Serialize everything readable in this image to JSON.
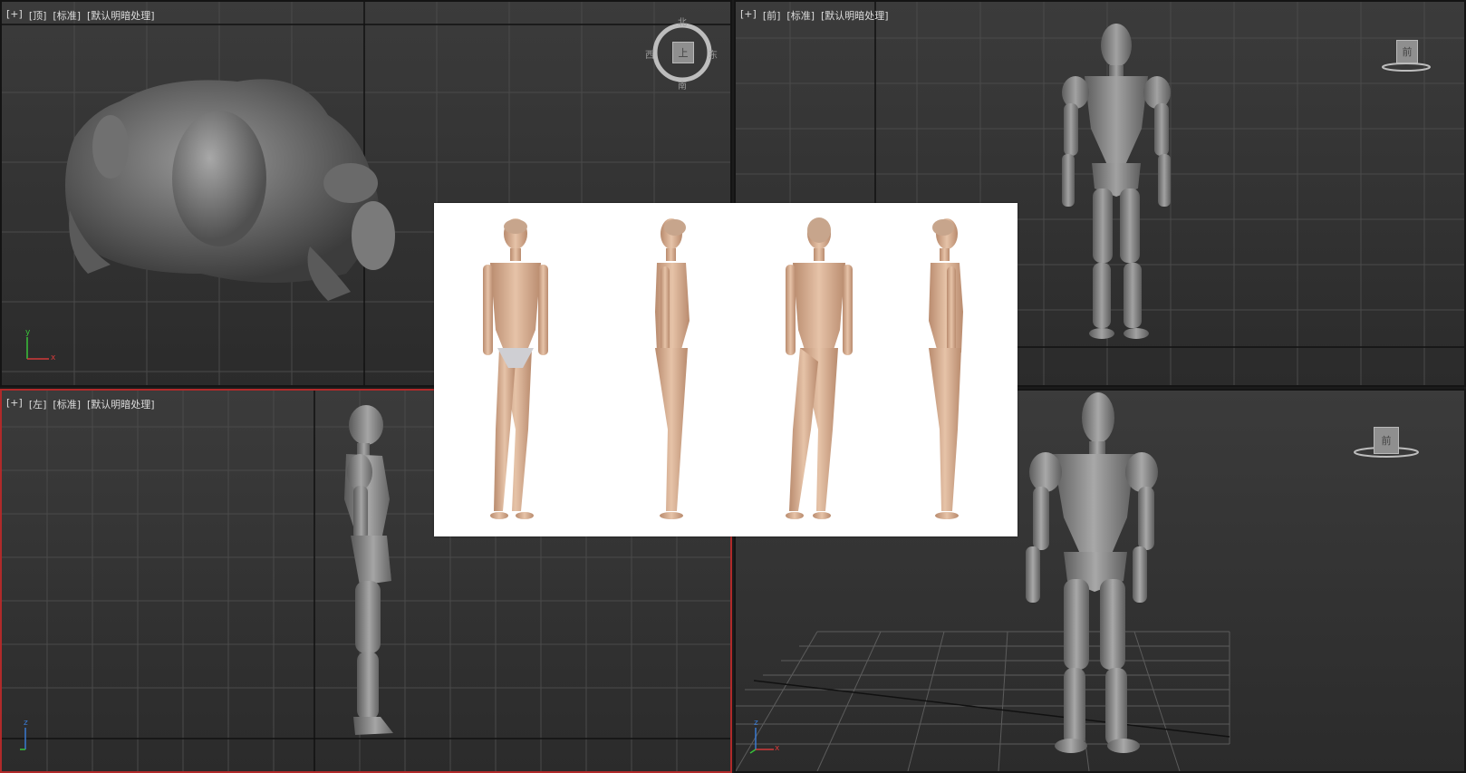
{
  "viewports": {
    "top": {
      "labels": [
        "[+]",
        "[顶]",
        "[标准]",
        "[默认明暗处理]"
      ]
    },
    "front": {
      "labels": [
        "[+]",
        "[前]",
        "[标准]",
        "[默认明暗处理]"
      ]
    },
    "left": {
      "labels": [
        "[+]",
        "[左]",
        "[标准]",
        "[默认明暗处理]"
      ]
    },
    "perspective": {
      "labels": []
    }
  },
  "viewcube": {
    "top": {
      "face": "上",
      "north": "北",
      "south": "南",
      "east": "东",
      "west": "西"
    },
    "front": {
      "face": "前"
    },
    "perspective": {
      "face": "前"
    }
  },
  "axes": {
    "x": "x",
    "y": "y",
    "z": "z"
  },
  "colors": {
    "viewport_bg": "#333333",
    "active_border": "#b02a2a",
    "grid_line": "#4a4a4a",
    "model_gray": "#8c8c8c",
    "axis_x": "#d23a3a",
    "axis_y": "#3ac23a",
    "axis_z": "#3a7ad2"
  }
}
